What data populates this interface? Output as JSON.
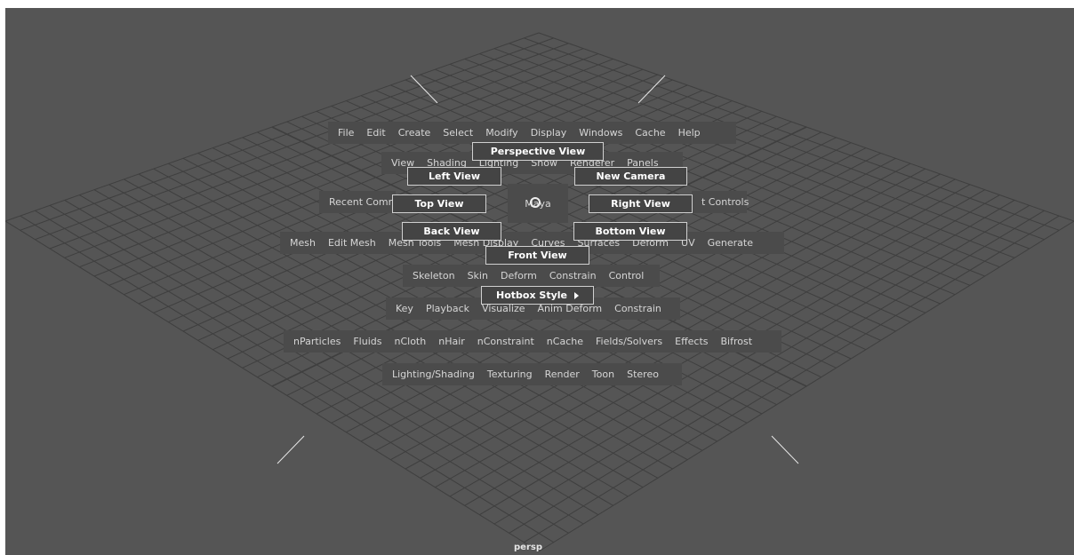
{
  "topmenu": [
    "File",
    "Edit",
    "Create",
    "Select",
    "Modify",
    "Display",
    "Windows",
    "Cache",
    "Help"
  ],
  "panelmenu": [
    "View",
    "Shading",
    "Lighting",
    "Show",
    "Renderer",
    "Panels"
  ],
  "recent": "Recent Comm",
  "controls": "t Controls",
  "center": "Maya",
  "meshmenu": [
    "Mesh",
    "Edit Mesh",
    "Mesh Tools",
    "Mesh Display",
    "Curves",
    "Surfaces",
    "Deform",
    "UV",
    "Generate"
  ],
  "riggingmenu": [
    "Skeleton",
    "Skin",
    "Deform",
    "Constrain",
    "Control"
  ],
  "animmenu": [
    "Key",
    "Playback",
    "Visualize",
    "Anim Deform",
    "Constrain"
  ],
  "fxmenu": [
    "nParticles",
    "Fluids",
    "nCloth",
    "nHair",
    "nConstraint",
    "nCache",
    "Fields/Solvers",
    "Effects",
    "Bifrost"
  ],
  "rendermenu": [
    "Lighting/Shading",
    "Texturing",
    "Render",
    "Toon",
    "Stereo"
  ],
  "views": {
    "perspective": "Perspective View",
    "left": "Left View",
    "new_camera": "New Camera",
    "top": "Top View",
    "right": "Right View",
    "back": "Back View",
    "bottom": "Bottom View",
    "front": "Front View"
  },
  "hotbox_style": "Hotbox Style",
  "camera_name": "persp",
  "icons": {
    "cursor": "cursor-ring-icon",
    "submenu": "submenu-arrow-icon"
  },
  "colors": {
    "viewport": "#555555",
    "grid": "#3f3f3f",
    "menu_bg": "#4b4b4b",
    "menu_text": "#d6d6d6"
  }
}
